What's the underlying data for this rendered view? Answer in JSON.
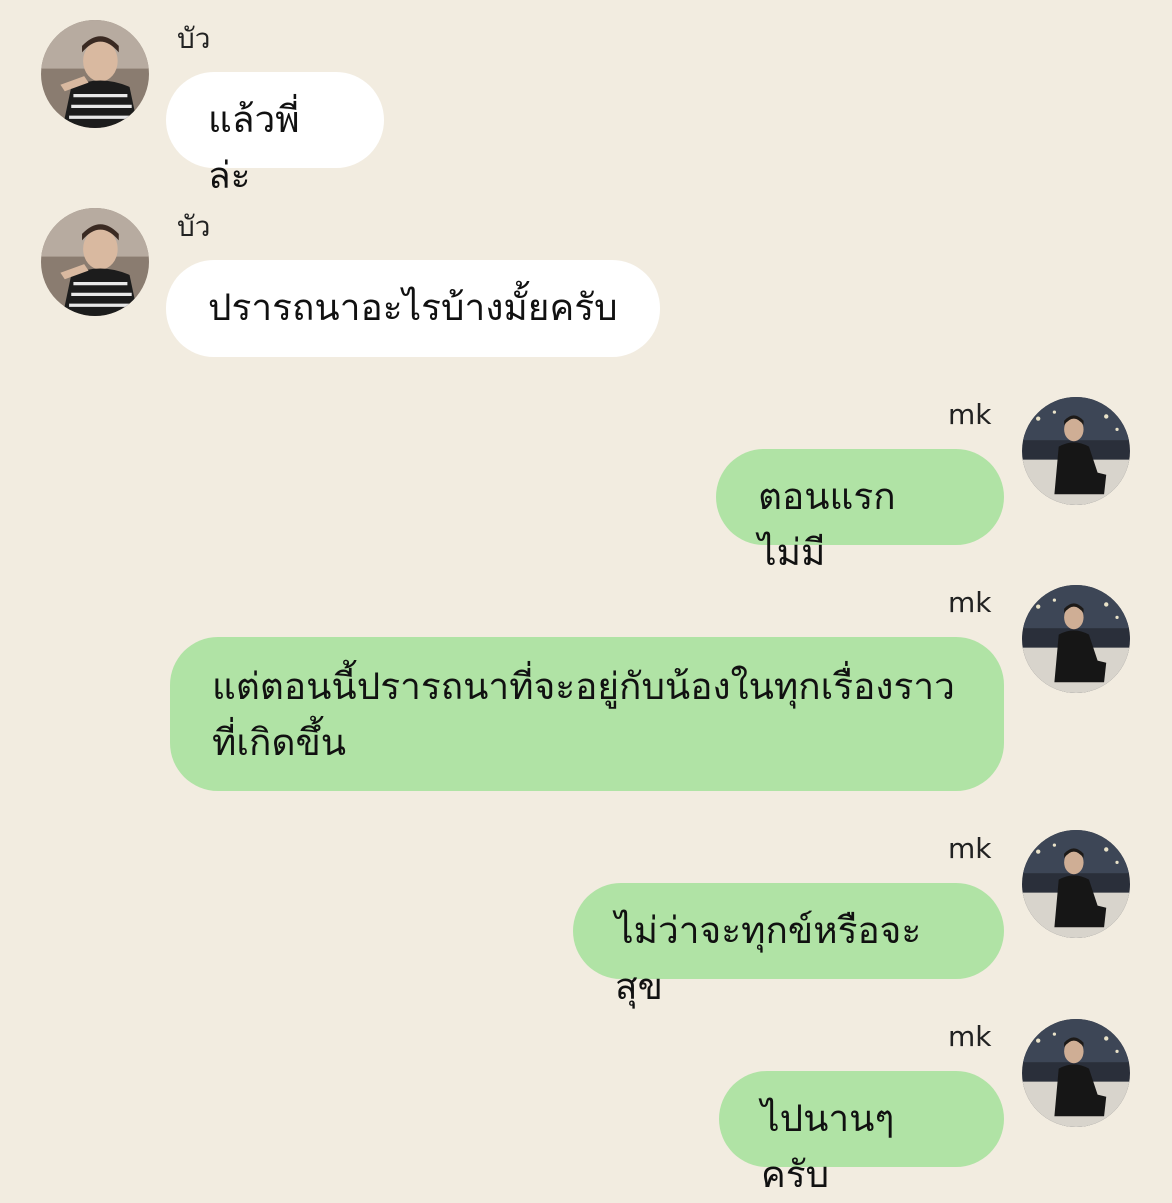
{
  "colors": {
    "background": "#f2ece0",
    "incoming_bubble": "#ffffff",
    "outgoing_bubble": "#b0e3a5"
  },
  "messages": [
    {
      "sender": "บัว",
      "text": "แล้วพี่ล่ะ",
      "direction": "incoming",
      "avatar": "user-photo-avatar"
    },
    {
      "sender": "บัว",
      "text": "ปรารถนาอะไรบ้างมั้ยครับ",
      "direction": "incoming",
      "avatar": "user-photo-avatar"
    },
    {
      "sender": "mk",
      "text": "ตอนแรกไม่มี",
      "direction": "outgoing",
      "avatar": "user-photo-avatar"
    },
    {
      "sender": "mk",
      "text": "แต่ตอนนี้ปรารถนาที่จะอยู่กับน้องในทุกเรื่องราว\nที่เกิดขึ้น",
      "direction": "outgoing",
      "avatar": "user-photo-avatar"
    },
    {
      "sender": "mk",
      "text": "ไม่ว่าจะทุกข์หรือจะสุข",
      "direction": "outgoing",
      "avatar": "user-photo-avatar"
    },
    {
      "sender": "mk",
      "text": "ไปนานๆครับ",
      "direction": "outgoing",
      "avatar": "user-photo-avatar"
    }
  ]
}
